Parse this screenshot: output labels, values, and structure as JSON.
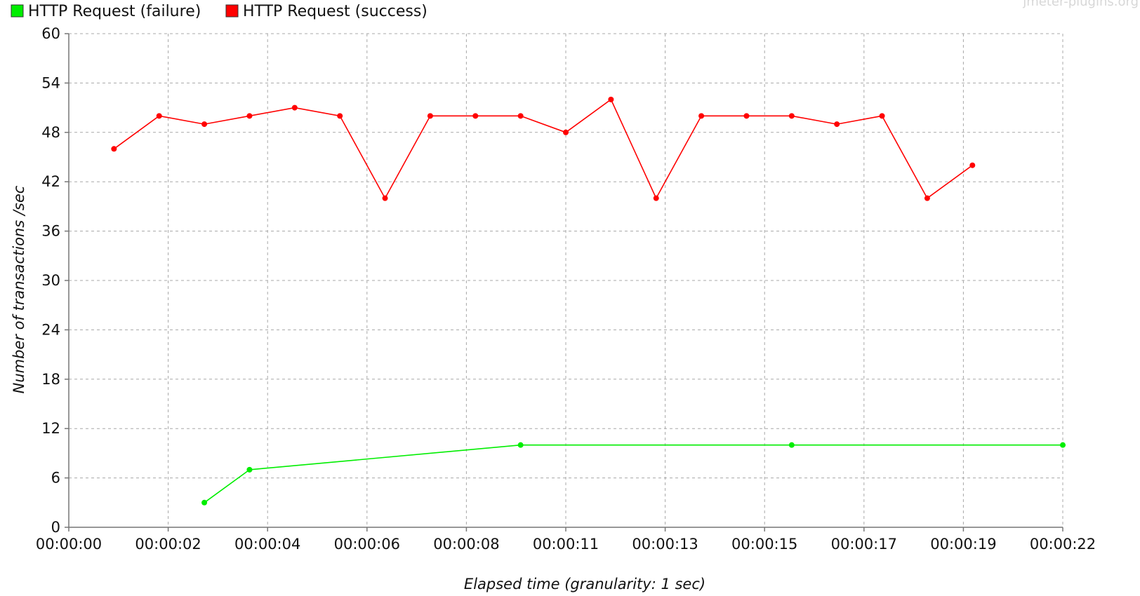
{
  "watermark": "jmeter-plugins.org",
  "chart_data": {
    "type": "line",
    "xlabel": "Elapsed time (granularity: 1 sec)",
    "ylabel": "Number of transactions /sec",
    "ylim": [
      0,
      60
    ],
    "yticks": [
      0,
      6,
      12,
      18,
      24,
      30,
      36,
      42,
      48,
      54,
      60
    ],
    "xlim": [
      "00:00:00",
      "00:00:22"
    ],
    "xticks": [
      "00:00:00",
      "00:00:02",
      "00:00:04",
      "00:00:06",
      "00:00:08",
      "00:00:11",
      "00:00:13",
      "00:00:15",
      "00:00:17",
      "00:00:19",
      "00:00:22"
    ],
    "grid": true,
    "legend_position": "top-left",
    "series": [
      {
        "name": "HTTP Request (failure)",
        "color": "#00ee00",
        "points": [
          {
            "x": "00:00:03",
            "y": 3
          },
          {
            "x": "00:00:04",
            "y": 7
          },
          {
            "x": "00:00:10",
            "y": 10
          },
          {
            "x": "00:00:16",
            "y": 10
          },
          {
            "x": "00:00:22",
            "y": 10
          }
        ]
      },
      {
        "name": "HTTP Request (success)",
        "color": "#ff0000",
        "points": [
          {
            "x": "00:00:01",
            "y": 46
          },
          {
            "x": "00:00:02",
            "y": 50
          },
          {
            "x": "00:00:03",
            "y": 49
          },
          {
            "x": "00:00:04",
            "y": 50
          },
          {
            "x": "00:00:05",
            "y": 51
          },
          {
            "x": "00:00:06",
            "y": 50
          },
          {
            "x": "00:00:07",
            "y": 40
          },
          {
            "x": "00:00:08",
            "y": 50
          },
          {
            "x": "00:00:09",
            "y": 50
          },
          {
            "x": "00:00:10",
            "y": 50
          },
          {
            "x": "00:00:11",
            "y": 48
          },
          {
            "x": "00:00:12",
            "y": 52
          },
          {
            "x": "00:00:13",
            "y": 40
          },
          {
            "x": "00:00:14",
            "y": 50
          },
          {
            "x": "00:00:15",
            "y": 50
          },
          {
            "x": "00:00:16",
            "y": 50
          },
          {
            "x": "00:00:17",
            "y": 49
          },
          {
            "x": "00:00:18",
            "y": 50
          },
          {
            "x": "00:00:19",
            "y": 40
          },
          {
            "x": "00:00:20",
            "y": 44
          }
        ]
      }
    ]
  }
}
